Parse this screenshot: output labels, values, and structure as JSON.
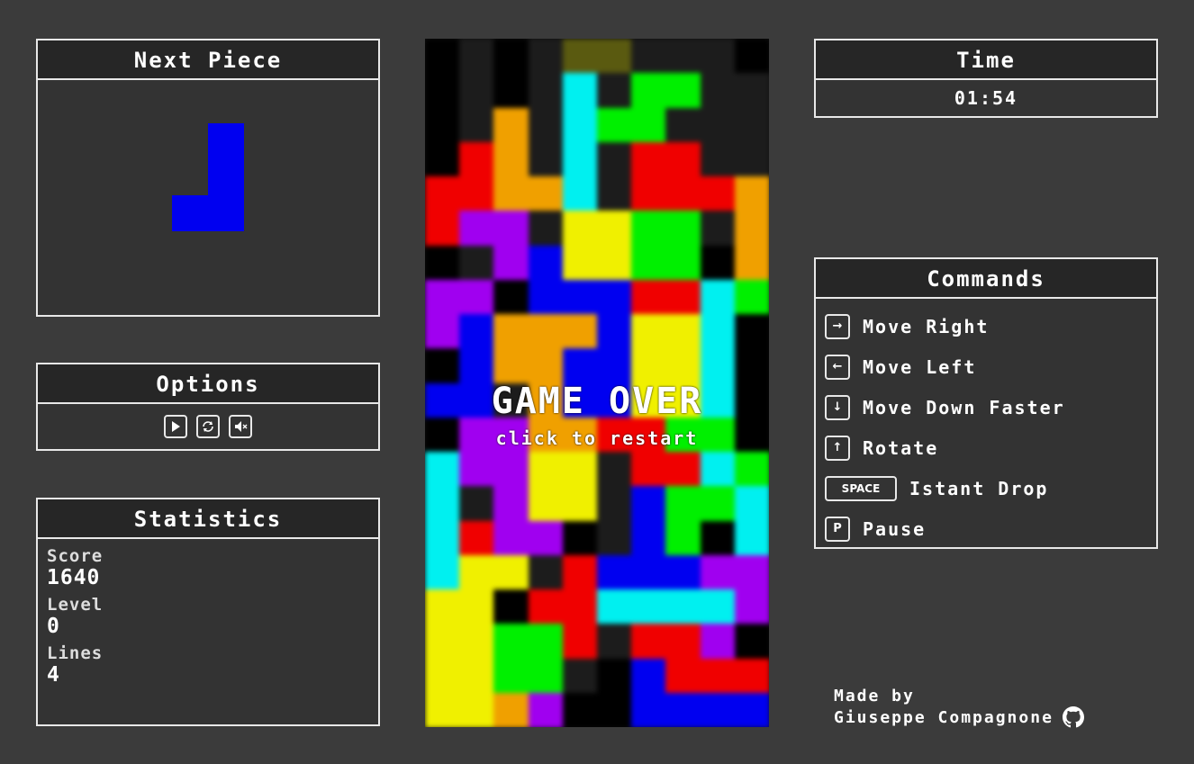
{
  "next_piece": {
    "title": "Next Piece",
    "color": "#0000f0",
    "shape": "J"
  },
  "options": {
    "title": "Options",
    "buttons": [
      {
        "name": "play-button",
        "icon": "play-icon"
      },
      {
        "name": "restart-button",
        "icon": "restart-icon"
      },
      {
        "name": "mute-button",
        "icon": "mute-icon"
      }
    ]
  },
  "statistics": {
    "title": "Statistics",
    "score_label": "Score",
    "score": "1640",
    "level_label": "Level",
    "level": "0",
    "lines_label": "Lines",
    "lines": "4"
  },
  "board": {
    "gameover_title": "GAME OVER",
    "gameover_sub": "click to restart",
    "colors": {
      "K": "#000000",
      "D": "#1c1c1c",
      "G": "#2a2a2a",
      "c": "#00f0f0",
      "y": "#f0f000",
      "p": "#a000f0",
      "g": "#00f000",
      "r": "#f00000",
      "b": "#0000f0",
      "o": "#f0a000",
      "O": "#5a5a10"
    },
    "rows": [
      "KDKDOODD DK",
      "KDKDcDggDD",
      "KDoDcggDDD",
      "KroDcDrrDD",
      "rroocDrrro",
      "rppDyyggDo",
      "KDpbyyggKo",
      "ppKbbbrrcg",
      "pbooobyycK",
      "KboobbyycK",
      "bbDobbyycK",
      "KppoorrggK",
      "cppyyDrrcg",
      "cDpyyDbggc",
      "crppKDbgKc",
      "cyyDrbbbpp",
      "yyKrrccccp",
      "yyggrDrrpK",
      "yyggDKbrrr",
      "yyopKKbbbb"
    ]
  },
  "time": {
    "title": "Time",
    "value": "01:54"
  },
  "commands": {
    "title": "Commands",
    "items": [
      {
        "key": "→",
        "label": "Move Right",
        "icon": "arrow-right-key-icon"
      },
      {
        "key": "←",
        "label": "Move Left",
        "icon": "arrow-left-key-icon"
      },
      {
        "key": "↓",
        "label": "Move Down Faster",
        "icon": "arrow-down-key-icon"
      },
      {
        "key": "↑",
        "label": "Rotate",
        "icon": "arrow-up-key-icon"
      },
      {
        "key": "SPACE",
        "label": "Istant Drop",
        "icon": "space-key-icon"
      },
      {
        "key": "P",
        "label": "Pause",
        "icon": "p-key-icon"
      }
    ]
  },
  "credits": {
    "line1": "Made by",
    "author": "Giuseppe Compagnone",
    "icon": "github-icon"
  }
}
